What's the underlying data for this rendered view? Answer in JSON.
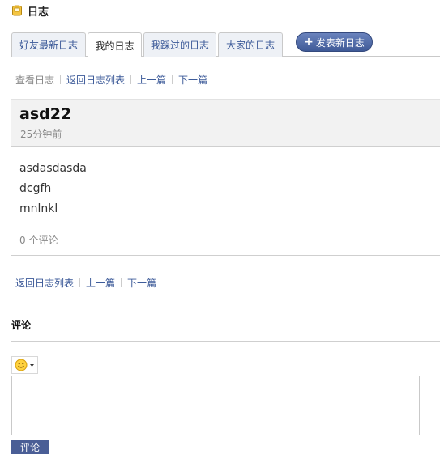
{
  "header": {
    "title": "日志"
  },
  "tabs": [
    {
      "label": "好友最新日志"
    },
    {
      "label": "我的日志"
    },
    {
      "label": "我踩过的日志"
    },
    {
      "label": "大家的日志"
    }
  ],
  "publish_button": {
    "label": "发表新日志"
  },
  "top_nav": {
    "current": "查看日志",
    "back": "返回日志列表",
    "prev": "上一篇",
    "next": "下一篇"
  },
  "post": {
    "title": "asd22",
    "time": "25分钟前",
    "lines": [
      "asdasdasda",
      "dcgfh",
      "mnlnkl"
    ],
    "comment_count": "0 个评论"
  },
  "bottom_nav": {
    "back": "返回日志列表",
    "prev": "上一篇",
    "next": "下一篇"
  },
  "comments": {
    "heading": "评论",
    "submit_label": "评论"
  }
}
